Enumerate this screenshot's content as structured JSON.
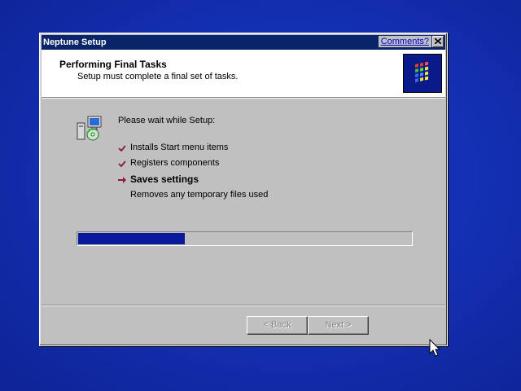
{
  "window": {
    "title": "Neptune Setup",
    "comments_link": "Comments?"
  },
  "header": {
    "title": "Performing Final Tasks",
    "subtitle": "Setup must complete a final set of tasks."
  },
  "main": {
    "intro": "Please wait while Setup:",
    "tasks": [
      {
        "label": "Installs Start menu items",
        "status": "done"
      },
      {
        "label": "Registers components",
        "status": "done"
      },
      {
        "label": "Saves settings",
        "status": "current"
      },
      {
        "label": "Removes any temporary files used",
        "status": "pending"
      }
    ],
    "progress_fraction": 0.32
  },
  "footer": {
    "back_label": "< Back",
    "next_label": "Next >"
  },
  "colors": {
    "desktop": "#1430b4",
    "titlebar": "#0a246a",
    "progress": "#0a1a9a",
    "check": "#8b1a3a"
  },
  "icons": {
    "close": "close-icon",
    "setup": "setup-computer-icon",
    "logo": "windows-logo-icon",
    "done": "checkmark-icon",
    "current": "arrow-right-icon",
    "cursor": "mouse-pointer-icon"
  }
}
